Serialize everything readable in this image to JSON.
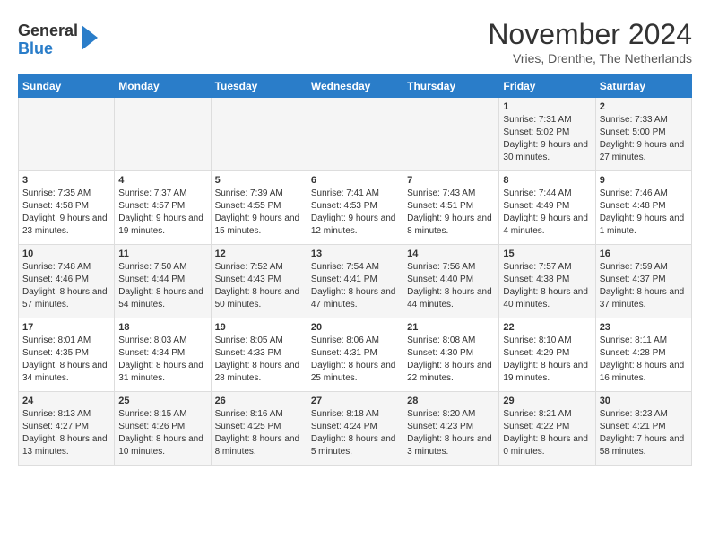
{
  "header": {
    "logo": {
      "general": "General",
      "blue": "Blue"
    },
    "title": "November 2024",
    "subtitle": "Vries, Drenthe, The Netherlands"
  },
  "days_of_week": [
    "Sunday",
    "Monday",
    "Tuesday",
    "Wednesday",
    "Thursday",
    "Friday",
    "Saturday"
  ],
  "weeks": [
    [
      {
        "day": "",
        "info": ""
      },
      {
        "day": "",
        "info": ""
      },
      {
        "day": "",
        "info": ""
      },
      {
        "day": "",
        "info": ""
      },
      {
        "day": "",
        "info": ""
      },
      {
        "day": "1",
        "info": "Sunrise: 7:31 AM\nSunset: 5:02 PM\nDaylight: 9 hours and 30 minutes."
      },
      {
        "day": "2",
        "info": "Sunrise: 7:33 AM\nSunset: 5:00 PM\nDaylight: 9 hours and 27 minutes."
      }
    ],
    [
      {
        "day": "3",
        "info": "Sunrise: 7:35 AM\nSunset: 4:58 PM\nDaylight: 9 hours and 23 minutes."
      },
      {
        "day": "4",
        "info": "Sunrise: 7:37 AM\nSunset: 4:57 PM\nDaylight: 9 hours and 19 minutes."
      },
      {
        "day": "5",
        "info": "Sunrise: 7:39 AM\nSunset: 4:55 PM\nDaylight: 9 hours and 15 minutes."
      },
      {
        "day": "6",
        "info": "Sunrise: 7:41 AM\nSunset: 4:53 PM\nDaylight: 9 hours and 12 minutes."
      },
      {
        "day": "7",
        "info": "Sunrise: 7:43 AM\nSunset: 4:51 PM\nDaylight: 9 hours and 8 minutes."
      },
      {
        "day": "8",
        "info": "Sunrise: 7:44 AM\nSunset: 4:49 PM\nDaylight: 9 hours and 4 minutes."
      },
      {
        "day": "9",
        "info": "Sunrise: 7:46 AM\nSunset: 4:48 PM\nDaylight: 9 hours and 1 minute."
      }
    ],
    [
      {
        "day": "10",
        "info": "Sunrise: 7:48 AM\nSunset: 4:46 PM\nDaylight: 8 hours and 57 minutes."
      },
      {
        "day": "11",
        "info": "Sunrise: 7:50 AM\nSunset: 4:44 PM\nDaylight: 8 hours and 54 minutes."
      },
      {
        "day": "12",
        "info": "Sunrise: 7:52 AM\nSunset: 4:43 PM\nDaylight: 8 hours and 50 minutes."
      },
      {
        "day": "13",
        "info": "Sunrise: 7:54 AM\nSunset: 4:41 PM\nDaylight: 8 hours and 47 minutes."
      },
      {
        "day": "14",
        "info": "Sunrise: 7:56 AM\nSunset: 4:40 PM\nDaylight: 8 hours and 44 minutes."
      },
      {
        "day": "15",
        "info": "Sunrise: 7:57 AM\nSunset: 4:38 PM\nDaylight: 8 hours and 40 minutes."
      },
      {
        "day": "16",
        "info": "Sunrise: 7:59 AM\nSunset: 4:37 PM\nDaylight: 8 hours and 37 minutes."
      }
    ],
    [
      {
        "day": "17",
        "info": "Sunrise: 8:01 AM\nSunset: 4:35 PM\nDaylight: 8 hours and 34 minutes."
      },
      {
        "day": "18",
        "info": "Sunrise: 8:03 AM\nSunset: 4:34 PM\nDaylight: 8 hours and 31 minutes."
      },
      {
        "day": "19",
        "info": "Sunrise: 8:05 AM\nSunset: 4:33 PM\nDaylight: 8 hours and 28 minutes."
      },
      {
        "day": "20",
        "info": "Sunrise: 8:06 AM\nSunset: 4:31 PM\nDaylight: 8 hours and 25 minutes."
      },
      {
        "day": "21",
        "info": "Sunrise: 8:08 AM\nSunset: 4:30 PM\nDaylight: 8 hours and 22 minutes."
      },
      {
        "day": "22",
        "info": "Sunrise: 8:10 AM\nSunset: 4:29 PM\nDaylight: 8 hours and 19 minutes."
      },
      {
        "day": "23",
        "info": "Sunrise: 8:11 AM\nSunset: 4:28 PM\nDaylight: 8 hours and 16 minutes."
      }
    ],
    [
      {
        "day": "24",
        "info": "Sunrise: 8:13 AM\nSunset: 4:27 PM\nDaylight: 8 hours and 13 minutes."
      },
      {
        "day": "25",
        "info": "Sunrise: 8:15 AM\nSunset: 4:26 PM\nDaylight: 8 hours and 10 minutes."
      },
      {
        "day": "26",
        "info": "Sunrise: 8:16 AM\nSunset: 4:25 PM\nDaylight: 8 hours and 8 minutes."
      },
      {
        "day": "27",
        "info": "Sunrise: 8:18 AM\nSunset: 4:24 PM\nDaylight: 8 hours and 5 minutes."
      },
      {
        "day": "28",
        "info": "Sunrise: 8:20 AM\nSunset: 4:23 PM\nDaylight: 8 hours and 3 minutes."
      },
      {
        "day": "29",
        "info": "Sunrise: 8:21 AM\nSunset: 4:22 PM\nDaylight: 8 hours and 0 minutes."
      },
      {
        "day": "30",
        "info": "Sunrise: 8:23 AM\nSunset: 4:21 PM\nDaylight: 7 hours and 58 minutes."
      }
    ]
  ]
}
